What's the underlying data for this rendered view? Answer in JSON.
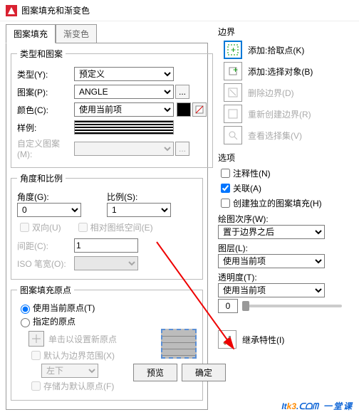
{
  "title": "图案填充和渐变色",
  "tabs": {
    "hatch": "图案填充",
    "gradient": "渐变色"
  },
  "typePattern": {
    "legend": "类型和图案",
    "typeLabel": "类型(Y):",
    "typeValue": "预定义",
    "patternLabel": "图案(P):",
    "patternValue": "ANGLE",
    "patternBtn": "...",
    "colorLabel": "颜色(C):",
    "colorValue": "使用当前项",
    "sampleLabel": "样例:",
    "customLabel": "自定义图案(M):"
  },
  "angleScale": {
    "legend": "角度和比例",
    "angleLabel": "角度(G):",
    "angleValue": "0",
    "scaleLabel": "比例(S):",
    "scaleValue": "1",
    "bidir": "双向(U)",
    "relPaper": "相对图纸空间(E)",
    "spacingLabel": "间距(C):",
    "spacingValue": "1",
    "isoLabel": "ISO 笔宽(O):"
  },
  "origin": {
    "legend": "图案填充原点",
    "useCurrent": "使用当前原点(T)",
    "specified": "指定的原点",
    "clickSet": "单击以设置新原点",
    "defaultBound": "默认为边界范围(X)",
    "pos": "左下",
    "storeDefault": "存储为默认原点(F)"
  },
  "boundary": {
    "title": "边界",
    "addPick": "添加:拾取点(K)",
    "addSelect": "添加:选择对象(B)",
    "remove": "删除边界(D)",
    "recreate": "重新创建边界(R)",
    "viewSel": "查看选择集(V)"
  },
  "options": {
    "title": "选项",
    "annotative": "注释性(N)",
    "assoc": "关联(A)",
    "indep": "创建独立的图案填充(H)",
    "drawOrderLabel": "绘图次序(W):",
    "drawOrderValue": "置于边界之后",
    "layerLabel": "图层(L):",
    "layerValue": "使用当前项",
    "transLabel": "透明度(T):",
    "transValue": "使用当前项",
    "transNum": "0",
    "inherit": "继承特性(I)"
  },
  "footer": {
    "preview": "预览",
    "ok": "确定"
  },
  "watermark": {
    "main1": "It",
    "main2": "k3",
    "main3": ".ᑕᗝᗰ",
    "sub": "一堂课"
  }
}
